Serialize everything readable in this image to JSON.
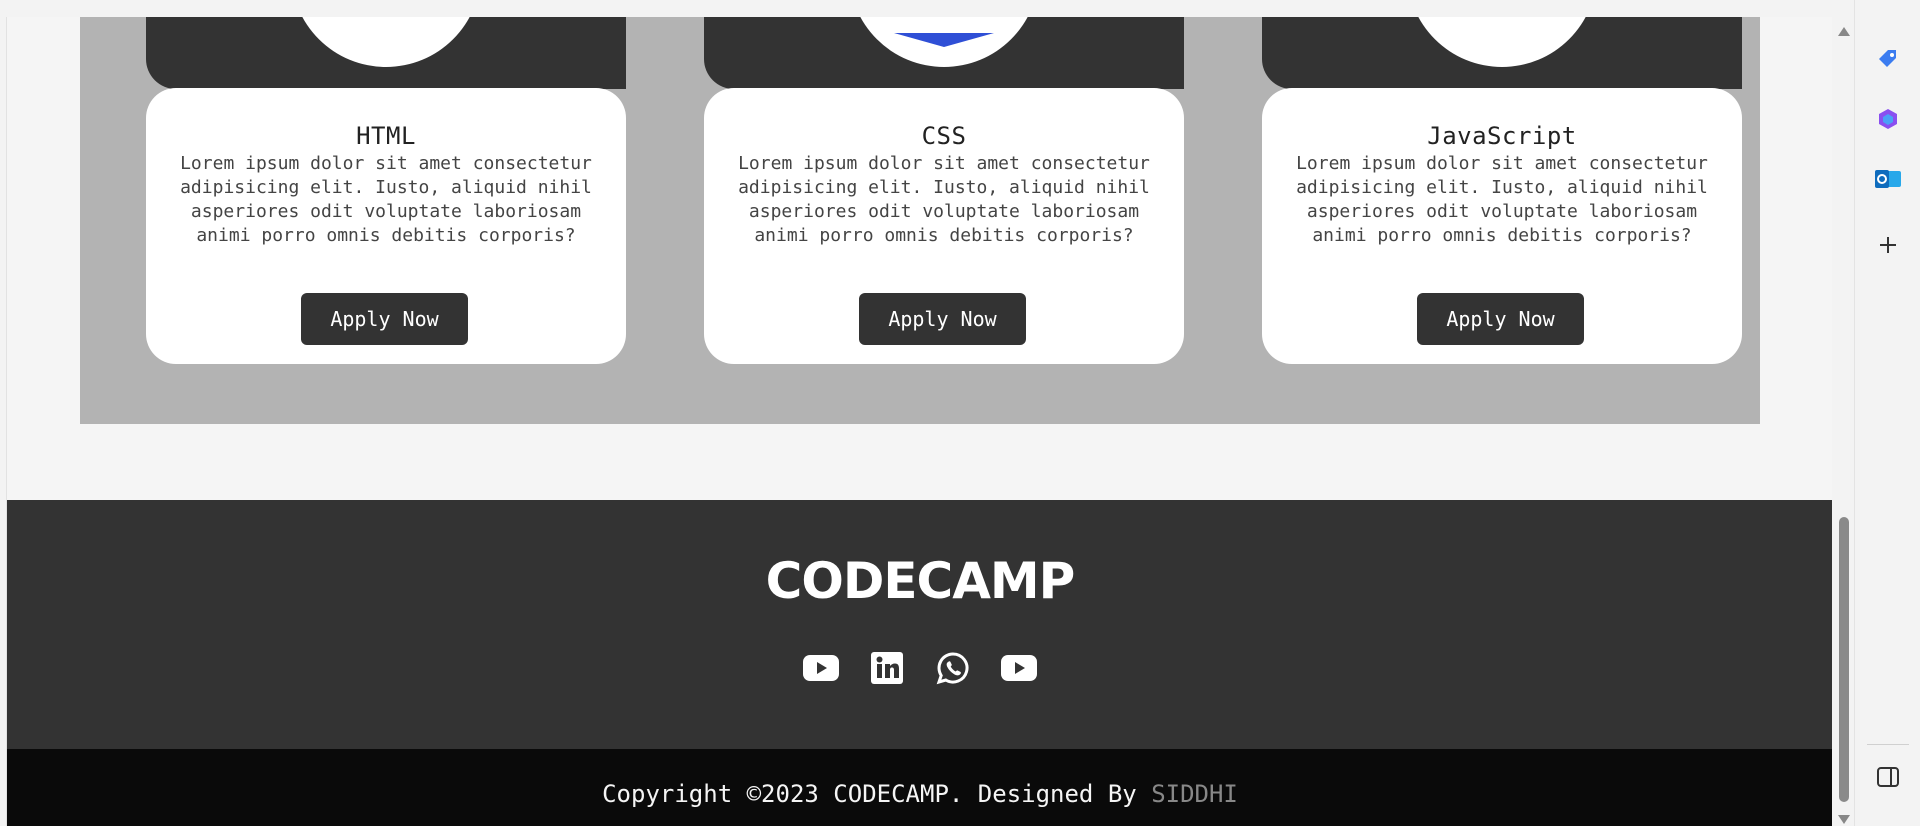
{
  "cards": [
    {
      "title": "HTML",
      "text": "Lorem ipsum dolor sit amet consectetur adipisicing elit. Iusto, aliquid nihil asperiores odit voluptate laboriosam animi porro omnis debitis corporis?",
      "button": "Apply Now",
      "icon": "html-logo-icon"
    },
    {
      "title": "CSS",
      "text": "Lorem ipsum dolor sit amet consectetur adipisicing elit. Iusto, aliquid nihil asperiores odit voluptate laboriosam animi porro omnis debitis corporis?",
      "button": "Apply Now",
      "icon": "css-logo-icon"
    },
    {
      "title": "JavaScript",
      "text": "Lorem ipsum dolor sit amet consectetur adipisicing elit. Iusto, aliquid nihil asperiores odit voluptate laboriosam animi porro omnis debitis corporis?",
      "button": "Apply Now",
      "icon": "javascript-logo-icon"
    }
  ],
  "footer": {
    "brand": "CODECAMP",
    "socials": [
      "youtube-icon",
      "linkedin-icon",
      "whatsapp-icon",
      "youtube-icon"
    ],
    "copyright": "Copyright ©2023 CODECAMP. Designed By",
    "designer": "SIDDHI"
  },
  "edge_sidebar": [
    "tag-icon",
    "copilot-icon",
    "outlook-icon",
    "add-icon",
    "sidebar-toggle-icon"
  ],
  "colors": {
    "section_bg": "#b3b3b3",
    "card_dark": "#333333",
    "footer_bg": "#333333",
    "copyright_bg": "#0a0a0a",
    "designer_text": "#888888",
    "css_logo": "#2f4fd6"
  }
}
